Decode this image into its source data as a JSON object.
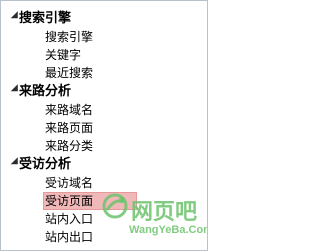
{
  "tree": {
    "categories": [
      {
        "label": "搜索引擎",
        "items": [
          {
            "label": "搜索引擎",
            "selected": false
          },
          {
            "label": "关键字",
            "selected": false
          },
          {
            "label": "最近搜索",
            "selected": false
          }
        ]
      },
      {
        "label": "来路分析",
        "items": [
          {
            "label": "来路域名",
            "selected": false
          },
          {
            "label": "来路页面",
            "selected": false
          },
          {
            "label": "来路分类",
            "selected": false
          }
        ]
      },
      {
        "label": "受访分析",
        "items": [
          {
            "label": "受访域名",
            "selected": false
          },
          {
            "label": "受访页面",
            "selected": true
          },
          {
            "label": "站内入口",
            "selected": false
          },
          {
            "label": "站内出口",
            "selected": false
          }
        ]
      }
    ]
  },
  "watermark": {
    "text": "网页吧",
    "url": "WangYeBa.Com",
    "color": "#6cc36c"
  },
  "colors": {
    "selected_bg": "#f0b8b8",
    "border": "#b9c2cc"
  }
}
